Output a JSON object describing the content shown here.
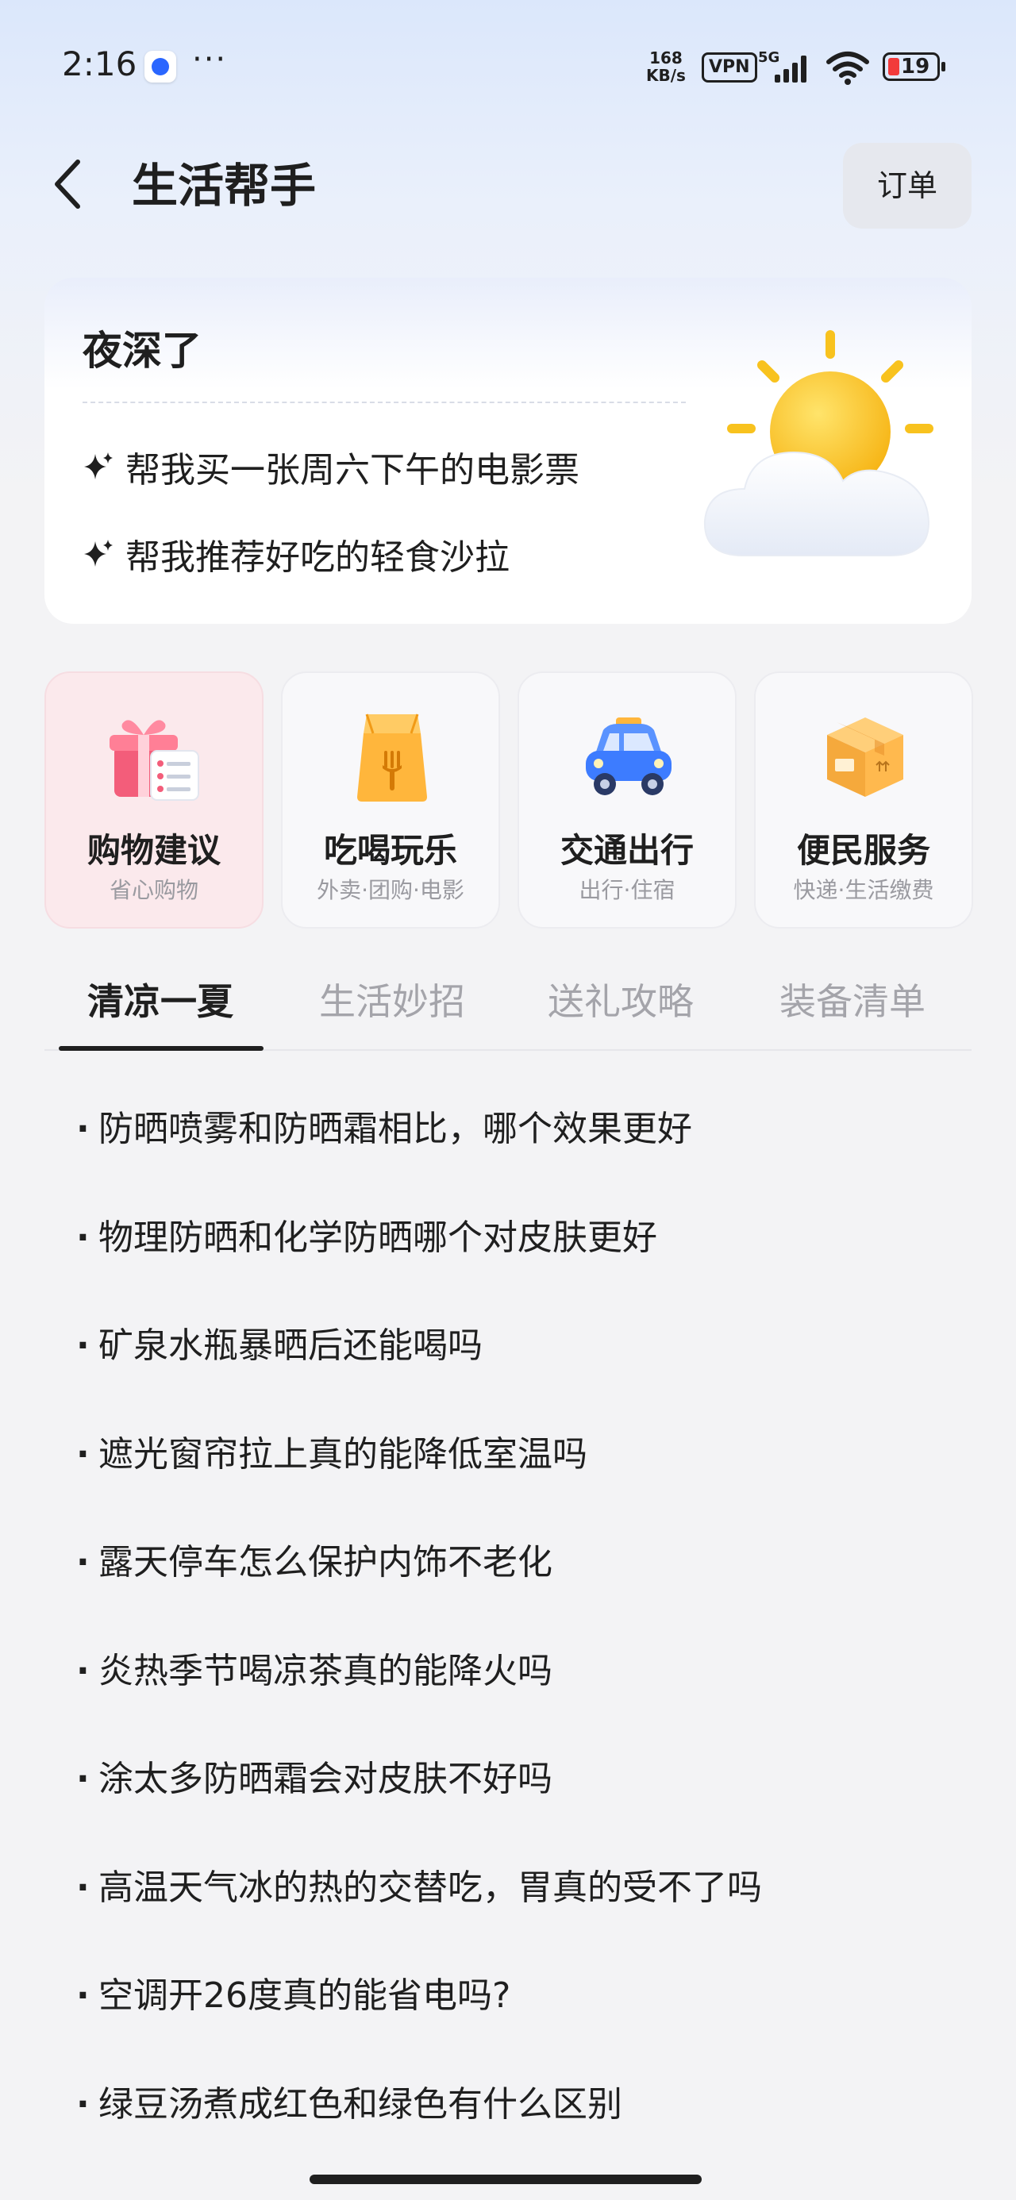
{
  "status_bar": {
    "time": "2:16",
    "more": "···",
    "speed_top": "168",
    "speed_bottom": "KB/s",
    "vpn": "VPN",
    "network": "5G",
    "battery": "19"
  },
  "header": {
    "title": "生活帮手",
    "order_button": "订单"
  },
  "greeting": {
    "title": "夜深了",
    "suggestions": [
      "帮我买一张周六下午的电影票",
      "帮我推荐好吃的轻食沙拉"
    ]
  },
  "categories": [
    {
      "title": "购物建议",
      "subtitle": "省心购物",
      "icon": "gift-icon"
    },
    {
      "title": "吃喝玩乐",
      "subtitle": "外卖·团购·电影",
      "icon": "food-bag-icon"
    },
    {
      "title": "交通出行",
      "subtitle": "出行·住宿",
      "icon": "taxi-icon"
    },
    {
      "title": "便民服务",
      "subtitle": "快递·生活缴费",
      "icon": "package-icon"
    }
  ],
  "tabs": [
    "清凉一夏",
    "生活妙招",
    "送礼攻略",
    "装备清单"
  ],
  "active_tab": "清凉一夏",
  "questions": [
    "防晒喷雾和防晒霜相比，哪个效果更好",
    "物理防晒和化学防晒哪个对皮肤更好",
    "矿泉水瓶暴晒后还能喝吗",
    "遮光窗帘拉上真的能降低室温吗",
    "露天停车怎么保护内饰不老化",
    "炎热季节喝凉茶真的能降火吗",
    "涂太多防晒霜会对皮肤不好吗",
    "高温天气冰的热的交替吃，胃真的受不了吗",
    "空调开26度真的能省电吗?",
    "绿豆汤煮成红色和绿色有什么区别"
  ],
  "colors": {
    "accent_active_card": "#fbe9ec",
    "battery_low": "#f23b3b",
    "text_primary": "#1f1f1f",
    "text_muted": "#9a9aa0"
  }
}
